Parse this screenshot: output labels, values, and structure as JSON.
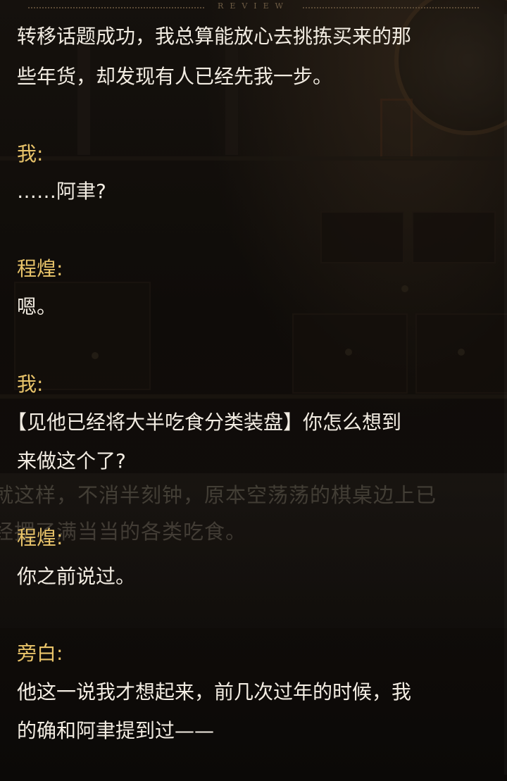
{
  "header": {
    "title": "REVIEW"
  },
  "ghost_narration": {
    "line1": "就这样，不消半刻钟，原本空荡荡的棋桌边上已",
    "line2": "经摆了满当当的各类吃食。"
  },
  "log": {
    "entries": [
      {
        "speaker": "",
        "lines": [
          "转移话题成功，我总算能放心去挑拣买来的那",
          "些年货，却发现有人已经先我一步。"
        ]
      },
      {
        "speaker": "我:",
        "lines": [
          "……阿聿?"
        ]
      },
      {
        "speaker": "程煌:",
        "lines": [
          "嗯。"
        ]
      },
      {
        "speaker": "我:",
        "lines": [
          "【见他已经将大半吃食分类装盘】你怎么想到",
          "来做这个了?"
        ]
      },
      {
        "speaker": "程煌:",
        "lines": [
          "你之前说过。"
        ]
      },
      {
        "speaker": "旁白:",
        "lines": [
          "他这一说我才想起来，前几次过年的时候，我",
          "的确和阿聿提到过——"
        ]
      }
    ]
  },
  "colors": {
    "speaker": "#e9c46a",
    "text": "#f2ece2",
    "background": "#0f0c09"
  }
}
